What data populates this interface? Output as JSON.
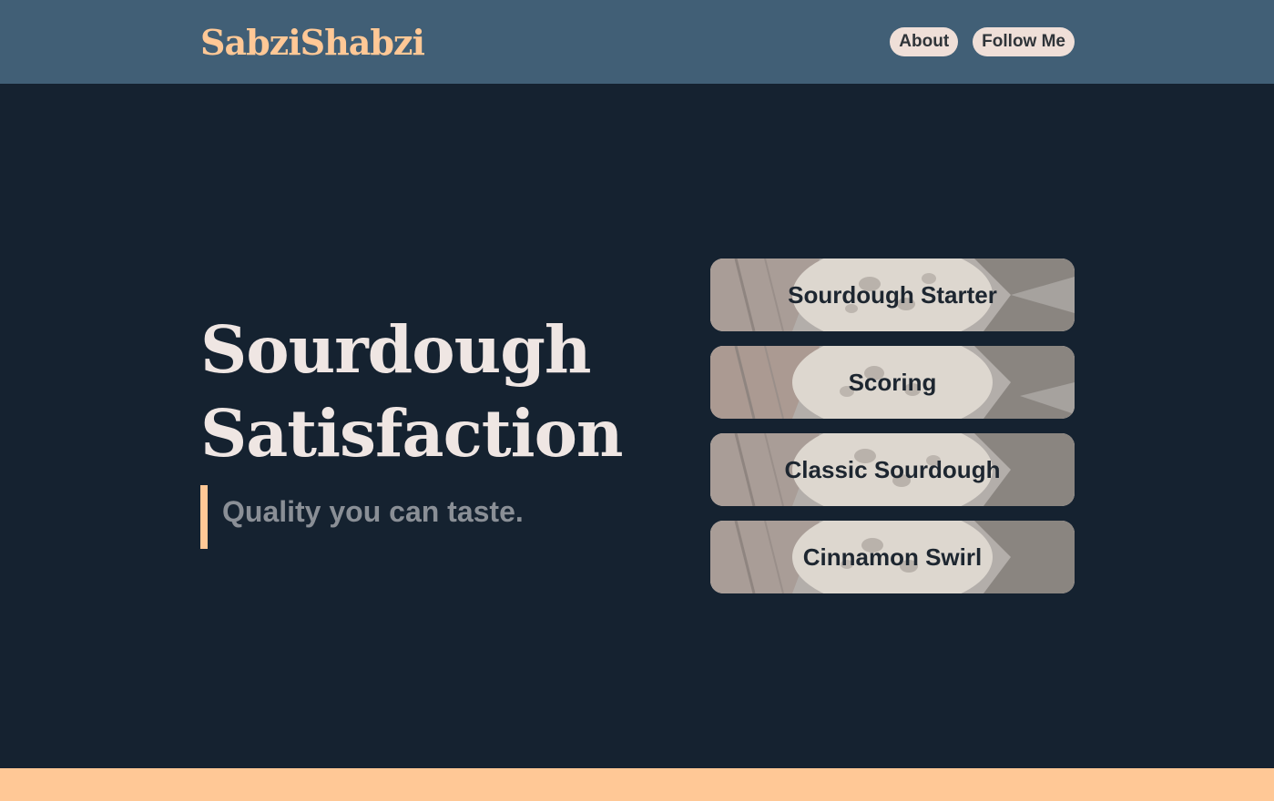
{
  "header": {
    "logo": "SabziShabzi",
    "nav": [
      {
        "label": "About"
      },
      {
        "label": "Follow Me"
      }
    ]
  },
  "hero": {
    "title_line1": "Sourdough",
    "title_line2": "Satisfaction",
    "tagline": "Quality you can taste."
  },
  "cards": [
    {
      "label": "Sourdough Starter"
    },
    {
      "label": "Scoring"
    },
    {
      "label": "Classic Sourdough"
    },
    {
      "label": "Cinnamon Swirl"
    }
  ],
  "colors": {
    "header_bg": "#415f76",
    "page_bg": "#152230",
    "accent": "#ffc896",
    "title_text": "#efe6e3",
    "nav_pill": "#efdfd8"
  }
}
